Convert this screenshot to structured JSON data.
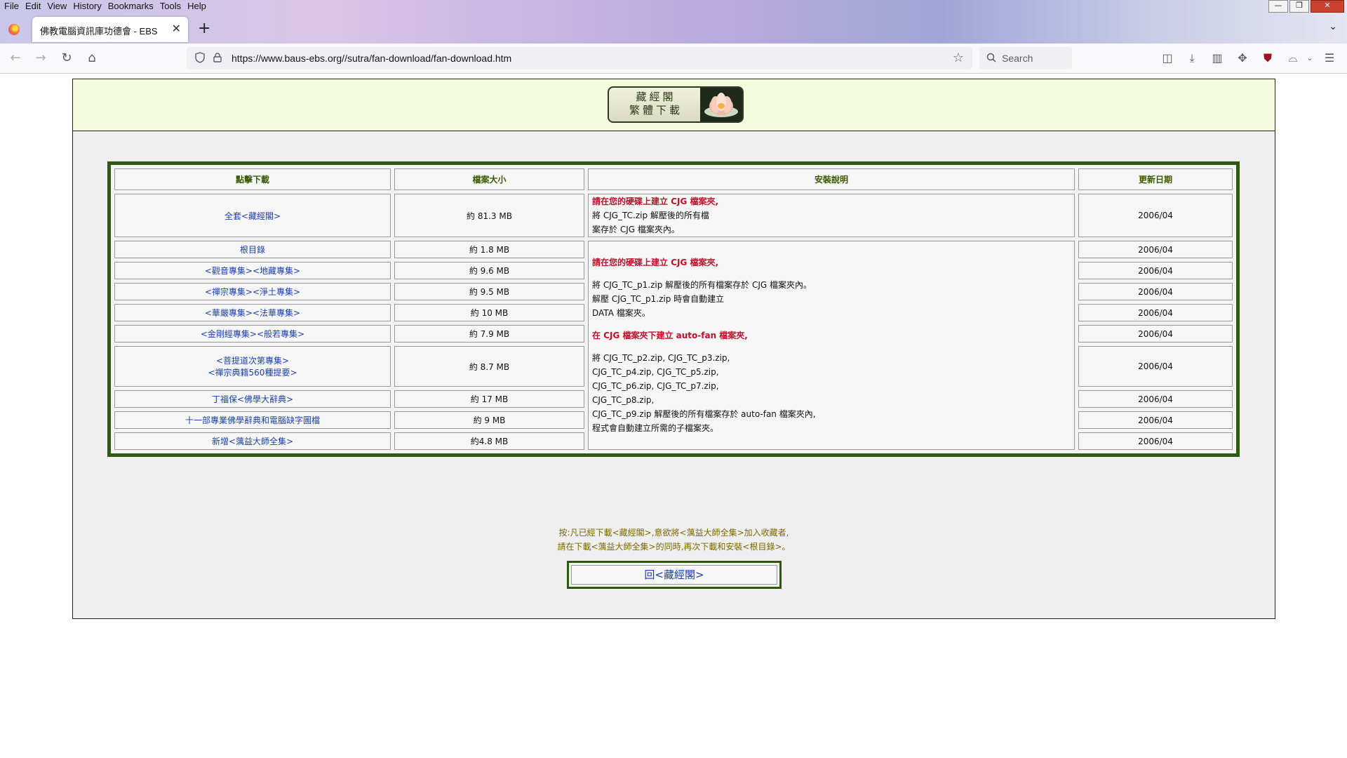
{
  "browser": {
    "menu": [
      "File",
      "Edit",
      "View",
      "History",
      "Bookmarks",
      "Tools",
      "Help"
    ],
    "tab_title": "佛教電腦資訊庫功德會 - EBS",
    "url": "https://www.baus-ebs.org//sutra/fan-download/fan-download.htm",
    "search_placeholder": "Search"
  },
  "banner": {
    "logo_line1": "藏經閣",
    "logo_line2": "繁體下載"
  },
  "table": {
    "headers": [
      "點擊下載",
      "檔案大小",
      "安裝說明",
      "更新日期"
    ],
    "rows": [
      {
        "name": "全套<藏經閣>",
        "size": "約 81.3 MB",
        "date": "2006/04"
      },
      {
        "name": "根目錄",
        "size": "約 1.8 MB",
        "date": "2006/04"
      },
      {
        "name": "<觀音專集><地藏專集>",
        "size": "約 9.6 MB",
        "date": "2006/04"
      },
      {
        "name": "<禪宗專集><淨土專集>",
        "size": "約 9.5 MB",
        "date": "2006/04"
      },
      {
        "name": "<華嚴專集><法華專集>",
        "size": "約 10 MB",
        "date": "2006/04"
      },
      {
        "name": "<金剛經專集><般若專集>",
        "size": "約 7.9 MB",
        "date": "2006/04"
      },
      {
        "name_line1": "<菩提道次第專集>",
        "name_line2": "<禪宗典籍560種提要>",
        "size": "約 8.7 MB",
        "date": "2006/04"
      },
      {
        "name": "丁福保<佛學大辭典>",
        "size": "約 17 MB",
        "date": "2006/04"
      },
      {
        "name": "十一部專業佛學辭典和電腦缺字圖檔",
        "size": "約 9 MB",
        "date": "2006/04"
      },
      {
        "name": "新增<蕅益大師全集>",
        "size": "約4.8 MB",
        "date": "2006/04"
      }
    ],
    "instructions_full": {
      "heading": "請在您的硬碟上建立 CJG 檔案夾,",
      "line1": "將 CJG_TC.zip 解壓後的所有檔",
      "line2": "案存於 CJG 檔案夾內。"
    },
    "instructions_parts": {
      "heading1": "請在您的硬碟上建立 CJG 檔案夾,",
      "p1_line1": "將 CJG_TC_p1.zip 解壓後的所有檔案存於 CJG 檔案夾內。",
      "p1_line2": "解壓 CJG_TC_p1.zip 時會自動建立",
      "p1_line3": "DATA 檔案夾。",
      "heading2": "在 CJG 檔案夾下建立 auto-fan 檔案夾,",
      "p2_line1": "將 CJG_TC_p2.zip, CJG_TC_p3.zip,",
      "p2_line2": "CJG_TC_p4.zip, CJG_TC_p5.zip,",
      "p2_line3": "CJG_TC_p6.zip, CJG_TC_p7.zip,",
      "p2_line4": "CJG_TC_p8.zip,",
      "p2_line5": "CJG_TC_p9.zip 解壓後的所有檔案存於 auto-fan 檔案夾內,",
      "p2_line6": "程式會自動建立所需的子檔案夾。"
    }
  },
  "note": {
    "line1": "按:凡已經下載<藏經閣>,意欲將<蕅益大師全集>加入收藏者,",
    "line2": "請在下載<蕅益大師全集>的同時,再次下載和安裝<根目錄>。"
  },
  "back_link": "回<藏經閣>"
}
